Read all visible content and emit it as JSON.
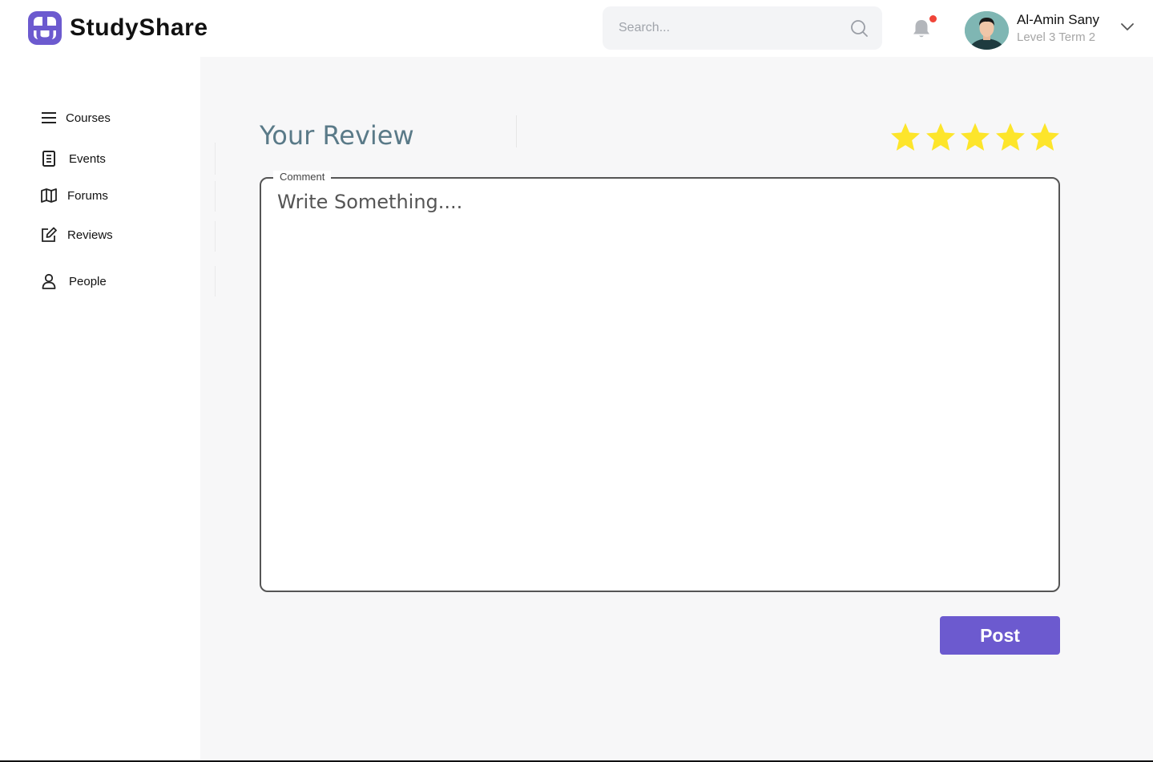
{
  "app": {
    "name": "StudyShare",
    "accent": "#6c5acf"
  },
  "header": {
    "search": {
      "placeholder": "Search...",
      "value": ""
    },
    "notifications": {
      "has_unread": true
    },
    "user": {
      "name": "Al-Amin Sany",
      "subtitle": "Level 3 Term 2"
    }
  },
  "sidebar": {
    "items": [
      {
        "label": "Courses",
        "icon": "menu-icon"
      },
      {
        "label": "Events",
        "icon": "document-icon"
      },
      {
        "label": "Forums",
        "icon": "map-icon"
      },
      {
        "label": "Reviews",
        "icon": "edit-icon"
      },
      {
        "label": "People",
        "icon": "person-icon"
      }
    ]
  },
  "review": {
    "title": "Your Review",
    "rating": 5,
    "rating_max": 5,
    "star_color": "#fde52b",
    "comment": {
      "legend": "Comment",
      "placeholder": "Write Something....",
      "value": ""
    },
    "post_label": "Post"
  }
}
